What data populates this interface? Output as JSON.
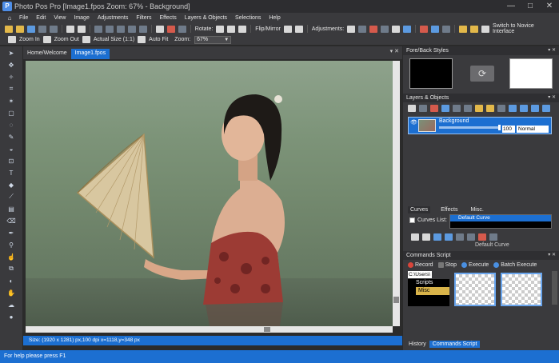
{
  "title": "Photo Pos Pro [Image1.fpos Zoom: 67% - Background]",
  "window_controls": {
    "minimize": "—",
    "maximize": "□",
    "close": "✕"
  },
  "menu": [
    "File",
    "Edit",
    "View",
    "Image",
    "Adjustments",
    "Filters",
    "Effects",
    "Layers & Objects",
    "Selections",
    "Help"
  ],
  "toolbar1": {
    "rotate": "Rotate:",
    "flip_mirror": "Flip/Mirror",
    "adjustments": "Adjustments:",
    "novice": "Switch to Novice Interface"
  },
  "toolbar2": {
    "zoom_in": "Zoom In",
    "zoom_out": "Zoom Out",
    "actual_size": "Actual Size (1:1)",
    "auto_fit": "Auto Fit",
    "zoom_label": "Zoom:",
    "zoom_value": "67%"
  },
  "doc_tabs": [
    "Home/Welcome",
    "Image1.fpos"
  ],
  "doc_status": "Size: (1920 x 1281) px,100 dpi   x=1118,y=348 px",
  "panels": {
    "fore_back": "Fore/Back Styles",
    "layers": "Layers & Objects",
    "layer": {
      "name": "Background",
      "opacity": "100",
      "blend": "Normal"
    },
    "subtabs": [
      "Curves",
      "Effects",
      "Misc."
    ],
    "curves_list_label": "Curves List:",
    "curves_list_item": "Default Curve",
    "curve_name": "Default Curve",
    "commands": "Commands Script",
    "cmd": {
      "record": "Record",
      "stop": "Stop",
      "execute": "Execute",
      "batch": "Batch Execute"
    },
    "path": "C:\\Users\\",
    "tree": [
      "Scripts",
      "Misc"
    ],
    "bottom_tabs": [
      "History",
      "Commands Script"
    ]
  },
  "status": "For help please press F1"
}
